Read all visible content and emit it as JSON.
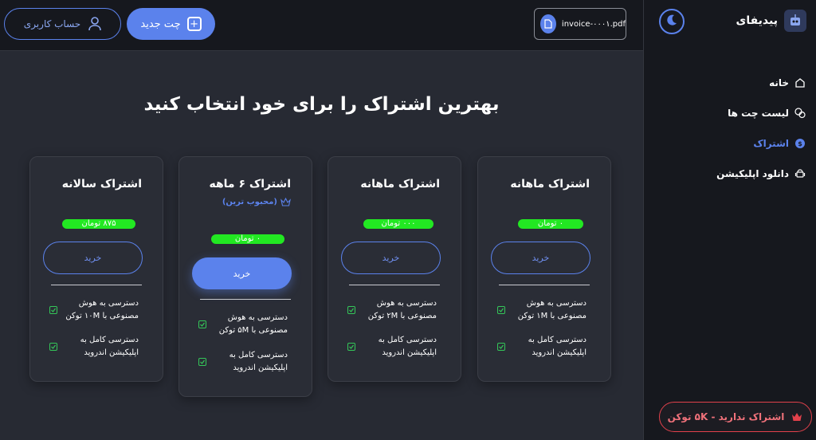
{
  "brand": {
    "name": "پیدیفای"
  },
  "sidebar": {
    "items": [
      {
        "label": "خانه",
        "icon": "home-icon",
        "active": false
      },
      {
        "label": "لیست چت ها",
        "icon": "chat-icon",
        "active": false
      },
      {
        "label": "اشتراک",
        "icon": "coin-icon",
        "active": true
      },
      {
        "label": "دانلود اپلیکیشن",
        "icon": "android-icon",
        "active": false
      }
    ],
    "subscription_status": "اشتراک ندارید - ۵K توکن"
  },
  "topbar": {
    "account_label": "حساب کاربری",
    "new_chat_label": "چت جدید",
    "file_name": "invoice-۰۰۰۱.pdf"
  },
  "main": {
    "heading": "بهترین اشتراک را برای خود انتخاب کنید",
    "plans": [
      {
        "title": "اشتراک ماهانه",
        "price": "۰ تومان",
        "buy_label": "خرید",
        "features": [
          "دسترسی به هوش مصنوعی با ۱M توکن",
          "دسترسی کامل به اپلیکیشن اندروید"
        ]
      },
      {
        "title": "اشتراک ماهانه",
        "price": "۰۰۰ تومان",
        "buy_label": "خرید",
        "features": [
          "دسترسی به هوش مصنوعی با ۲M توکن",
          "دسترسی کامل به اپلیکیشن اندروید"
        ]
      },
      {
        "title": "اشتراک ۶ ماهه",
        "badge": "(محبوب ترین)",
        "price": "۰ تومان",
        "buy_label": "خرید",
        "features": [
          "دسترسی به هوش مصنوعی با ۵M توکن",
          "دسترسی کامل به اپلیکیشن اندروید"
        ]
      },
      {
        "title": "اشتراک سالانه",
        "price": "۸۷۵ تومان",
        "buy_label": "خرید",
        "features": [
          "دسترسی به هوش مصنوعی با ۱۰M توکن",
          "دسترسی کامل به اپلیکیشن اندروید"
        ]
      }
    ]
  },
  "colors": {
    "accent": "#5b82ec",
    "danger": "#e2414b",
    "check": "#34c759",
    "price_redaction": "#22e822"
  }
}
